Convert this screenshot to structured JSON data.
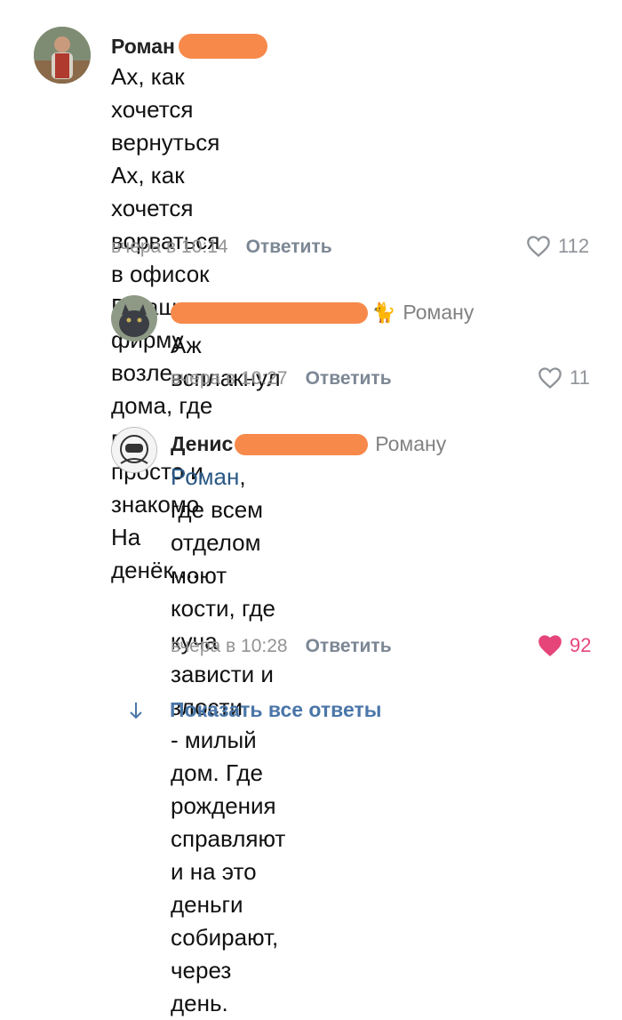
{
  "comments": [
    {
      "author": "Роман",
      "lines": [
        "Ах, как хочется вернуться",
        "Ах, как хочется ворваться в офисок",
        "В нашу фирму возле дома, где всё",
        "просто и знакомо",
        "На денёк....."
      ],
      "time": "вчера в 10:14",
      "reply_label": "Ответить",
      "likes": "112",
      "liked": false
    },
    {
      "author": "",
      "reply_to": "Роману",
      "lines": [
        "Аж всплакнул"
      ],
      "time": "вчера в 10:27",
      "reply_label": "Ответить",
      "likes": "11",
      "liked": false
    },
    {
      "author": "Денис",
      "reply_to": "Роману",
      "mention": "Роман",
      "lines": [
        ", где всем отделом моют",
        "кости, где куча зависти и злости",
        "- милый дом. Где рождения",
        "справляют и на это деньги",
        "собирают, через день."
      ],
      "time": "вчера в 10:28",
      "reply_label": "Ответить",
      "likes": "92",
      "liked": true
    }
  ],
  "show_all_label": "Показать все ответы",
  "colors": {
    "link": "#2a5885",
    "like_active": "#e6457a",
    "redaction": "#f7894b",
    "meta": "#939393"
  },
  "icons": [
    "heart-icon",
    "cat-emoji-icon",
    "arrow-down-icon"
  ]
}
